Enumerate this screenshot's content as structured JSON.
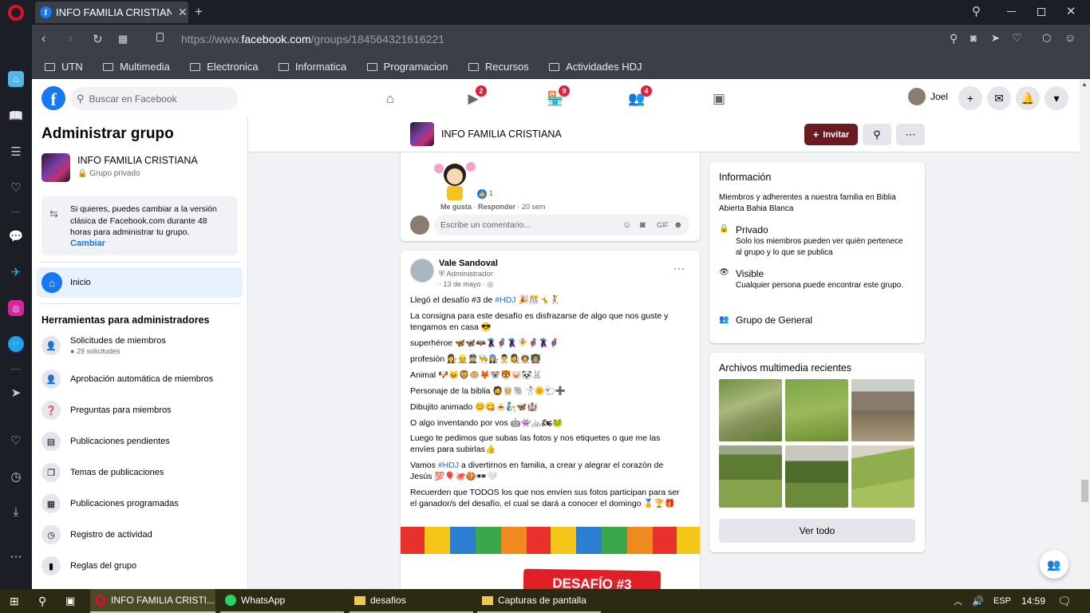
{
  "browser": {
    "tab_title": "INFO FAMILIA CRISTIANA |",
    "url_base": "https://www.",
    "url_host": "facebook.com",
    "url_path": "/groups/184564321616221",
    "bookmarks": [
      "UTN",
      "Multimedia",
      "Electronica",
      "Informatica",
      "Programacion",
      "Recursos",
      "Actividades HDJ"
    ]
  },
  "fb_header": {
    "search_placeholder": "Buscar en Facebook",
    "badges": {
      "watch": "2",
      "marketplace": "9",
      "groups": "4"
    },
    "user_name": "Joel"
  },
  "left_panel": {
    "title": "Administrar grupo",
    "group_name": "INFO FAMILIA CRISTIANA",
    "group_privacy": "Grupo privado",
    "notice_text": "Si quieres, puedes cambiar a la versión clásica de Facebook.com durante 48 horas para administrar tu grupo.",
    "notice_link": "Cambiar",
    "home_label": "Inicio",
    "tools_heading": "Herramientas para administradores",
    "tools": [
      {
        "label": "Solicitudes de miembros",
        "sub": "29 solicitudes"
      },
      {
        "label": "Aprobación automática de miembros"
      },
      {
        "label": "Preguntas para miembros"
      },
      {
        "label": "Publicaciones pendientes"
      },
      {
        "label": "Temas de publicaciones"
      },
      {
        "label": "Publicaciones programadas"
      },
      {
        "label": "Registro de actividad"
      },
      {
        "label": "Reglas del grupo"
      }
    ]
  },
  "group_header": {
    "name": "INFO FAMILIA CRISTIANA",
    "invite_label": "Invitar"
  },
  "prev_post": {
    "reaction_count": "1",
    "like_label": "Me gusta",
    "reply_label": "Responder",
    "time": "20 sem",
    "comment_placeholder": "Escribe un comentario..."
  },
  "post": {
    "author": "Vale Sandoval",
    "role": "Administrador",
    "date": "13 de mayo",
    "lines": [
      [
        "Llegó el desafío #3 de ",
        "#HDJ",
        " 🎉🎊🤸🤾"
      ],
      [
        "La consigna para este desafío es disfrazarse de algo que nos guste y tengamos en casa 😎"
      ],
      [
        "superhéroe 🦋🦋🦇🦹🦸🦹🧚🦸🦹🦸"
      ],
      [
        "profesión 👩‍⚖️👷👮👨‍🍳👩‍🔧👨‍⚕️👩‍🎨👨‍🚀👩‍🏫"
      ],
      [
        "Animal 🐶🐱🦁🐵🦊🐨🐯🐷🐼🐰"
      ],
      [
        "Personaje de la biblia 🧔👳🐘🤺🌞🐑➕"
      ],
      [
        "Dibujito animado 😊😋🍝🧞🦋🏰"
      ],
      [
        "O algo inventando por vos 🤖👾🚲🏍🐸"
      ],
      [
        "Luego te pedimos que subas las fotos y nos etiquetes o que me las envíes para subirlas👍"
      ],
      [
        "Vamos ",
        "#HDJ",
        " a divertirnos  en familia, a crear y alegrar el corazón de Jesús 💯🎈🐙🍪🕶🤍"
      ],
      [
        "Recuerden que TODOS los que nos envíen sus fotos participan para ser el ganador/s del desafío, el cual se dará a conocer el domingo 🏅🏆🎁"
      ]
    ],
    "banner_text": "DESAFÍO #3"
  },
  "info_card": {
    "title": "Información",
    "description": "Miembros y adherentes a nuestra familia en Biblia Abierta Bahia Blanca",
    "privacy_title": "Privado",
    "privacy_text": "Solo los miembros pueden ver quién pertenece al grupo y lo que se publica",
    "visible_title": "Visible",
    "visible_text": "Cualquier persona puede encontrar este grupo.",
    "general_label": "Grupo de General"
  },
  "media_card": {
    "title": "Archivos multimedia recientes",
    "see_all": "Ver todo"
  },
  "taskbar": {
    "items": [
      "INFO FAMILIA CRISTI...",
      "WhatsApp",
      "desafios",
      "Capturas de pantalla"
    ],
    "lang": "ESP",
    "time": "14:59"
  },
  "colors": {
    "fb_blue": "#1877f2",
    "invite_bg": "#6b1a21",
    "badge_red": "#e41e3f"
  }
}
